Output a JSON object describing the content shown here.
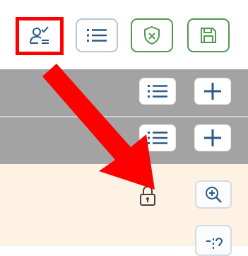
{
  "toolbar": {
    "buttons": [
      {
        "icon": "user-check-icon",
        "selected": true
      },
      {
        "icon": "list-icon"
      },
      {
        "icon": "shield-x-icon",
        "accent": "#4f9a4f"
      },
      {
        "icon": "save-icon",
        "accent": "#4f9a4f"
      }
    ]
  },
  "sections": [
    {
      "icons": [
        "list-icon",
        "plus-icon"
      ]
    },
    {
      "icons": [
        "list-icon",
        "plus-icon"
      ]
    }
  ],
  "content": {
    "icons": [
      "lock-icon",
      "zoom-in-icon",
      "partial-icon"
    ]
  },
  "colors": {
    "highlight": "#ff0000",
    "arrow": "#ff0000",
    "icon_blue": "#2a5a88",
    "icon_green": "#4f9a4f",
    "band_gray": "#a3a3a3",
    "content_bg": "#fdf2e3"
  }
}
